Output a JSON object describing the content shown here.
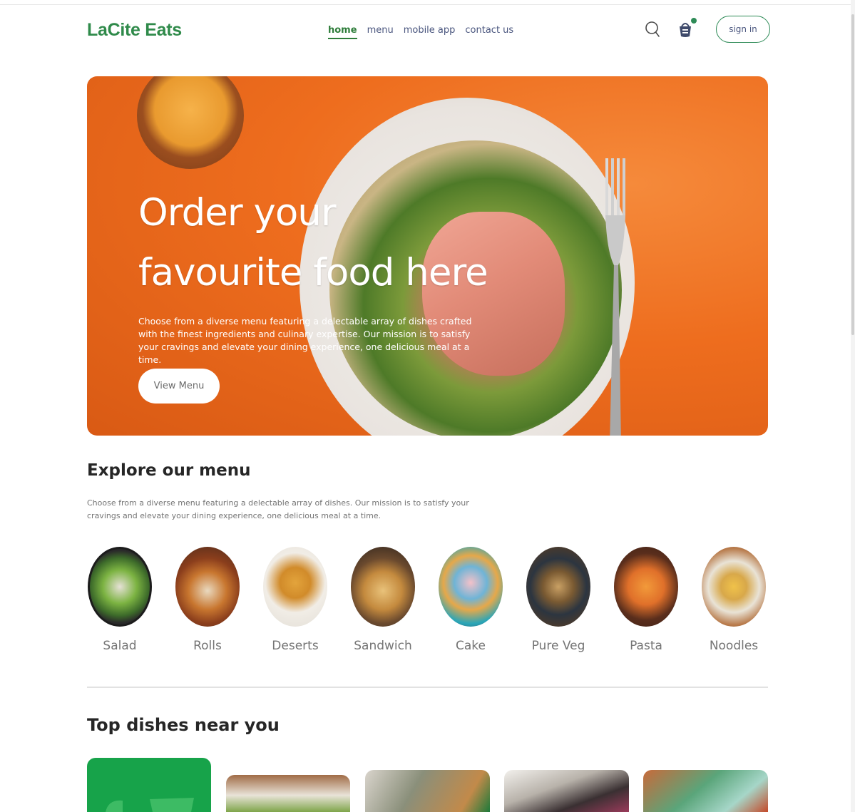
{
  "brand": {
    "name": "LaCite Eats"
  },
  "nav": {
    "items": [
      {
        "label": "home",
        "active": true
      },
      {
        "label": "menu",
        "active": false
      },
      {
        "label": "mobile app",
        "active": false
      },
      {
        "label": "contact us",
        "active": false
      }
    ],
    "search_icon": "search-icon",
    "basket_icon": "basket-icon",
    "signin_label": "sign in"
  },
  "hero": {
    "title_line1": "Order your",
    "title_line2": "favourite food here",
    "description": "Choose from a diverse menu featuring a delectable array of dishes crafted with the finest ingredients and culinary expertise. Our mission is to satisfy your cravings and elevate your dining experience, one delicious meal at a time.",
    "button_label": "View Menu"
  },
  "explore": {
    "title": "Explore our menu",
    "description": "Choose from a diverse menu featuring a delectable array of dishes. Our mission is to satisfy your cravings and elevate your dining experience, one delicious meal at a time.",
    "items": [
      {
        "label": "Salad"
      },
      {
        "label": "Rolls"
      },
      {
        "label": "Deserts"
      },
      {
        "label": "Sandwich"
      },
      {
        "label": "Cake"
      },
      {
        "label": "Pure Veg"
      },
      {
        "label": "Pasta"
      },
      {
        "label": "Noodles"
      }
    ]
  },
  "top_dishes": {
    "title": "Top dishes near you"
  },
  "colors": {
    "accent": "#2e8b57",
    "hero": "#ee6d1e",
    "text": "#262626",
    "muted": "#747474"
  }
}
